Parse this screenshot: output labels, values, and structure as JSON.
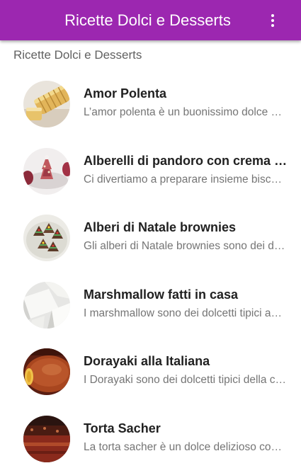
{
  "app_bar": {
    "title": "Ricette Dolci e Desserts",
    "background_color": "#9c27b0",
    "overflow_icon": "more-vert-icon"
  },
  "section_header": "Ricette Dolci e Desserts",
  "recipes": [
    {
      "title": "Amor Polenta",
      "subtitle": "L’amor polenta è un buonissimo dolce della tradizione"
    },
    {
      "title": "Alberelli di pandoro con crema pasticcera",
      "subtitle": "Ci divertiamo a preparare insieme biscotti e dolcetti"
    },
    {
      "title": "Alberi di Natale brownies",
      "subtitle": "Gli alberi di Natale brownies sono dei dolcetti"
    },
    {
      "title": "Marshmallow fatti in casa",
      "subtitle": "I marshmallow sono dei dolcetti tipici americani"
    },
    {
      "title": "Dorayaki alla Italiana",
      "subtitle": "I Dorayaki sono dei dolcetti tipici della cucina giapponese"
    },
    {
      "title": "Torta Sacher",
      "subtitle": "La torta sacher è un dolce delizioso conosciuto"
    }
  ]
}
